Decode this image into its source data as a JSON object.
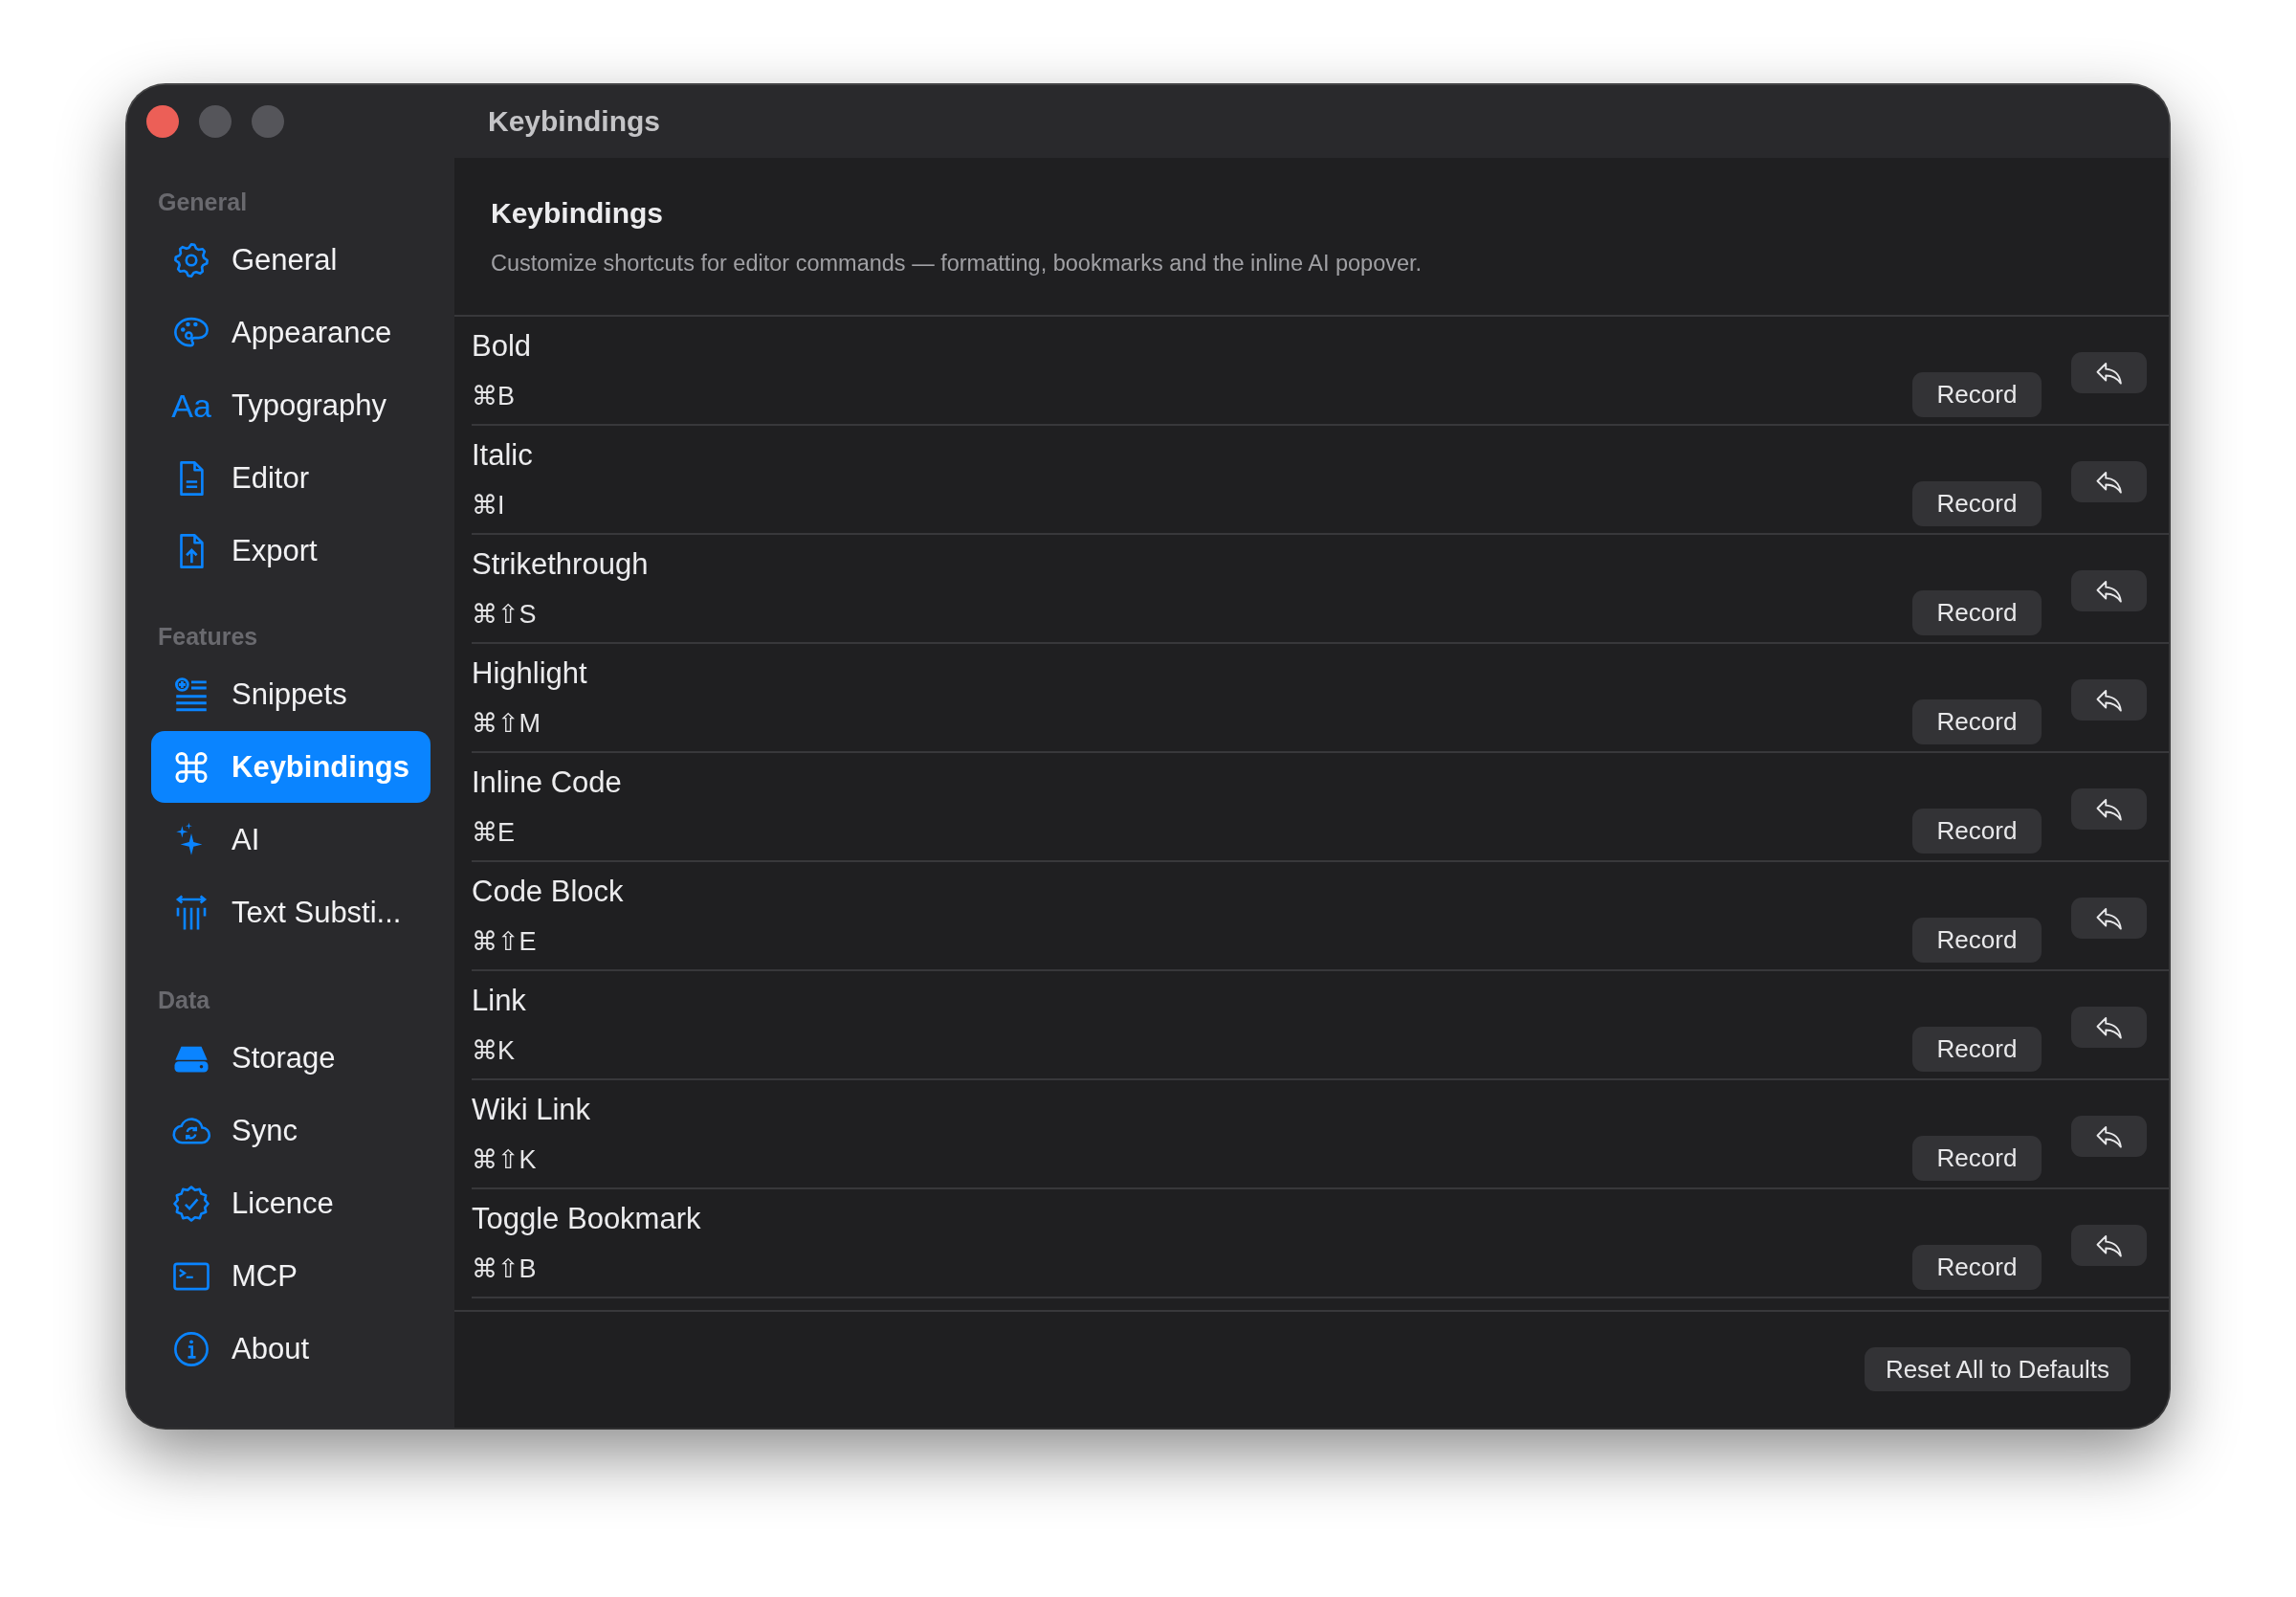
{
  "window": {
    "title": "Keybindings",
    "traffic_lights": [
      {
        "color": "#ec5f57"
      },
      {
        "color": "#55555a"
      },
      {
        "color": "#55555a"
      }
    ]
  },
  "sidebar": {
    "sections": [
      {
        "title": "General",
        "items": [
          {
            "label": "General",
            "selected": false
          },
          {
            "label": "Appearance",
            "selected": false
          },
          {
            "label": "Typography",
            "icon_glyph": "Aa",
            "selected": false
          },
          {
            "label": "Editor",
            "selected": false
          },
          {
            "label": "Export",
            "selected": false
          }
        ]
      },
      {
        "title": "Features",
        "items": [
          {
            "label": "Snippets",
            "selected": false
          },
          {
            "label": "Keybindings",
            "selected": true
          },
          {
            "label": "AI",
            "selected": false
          },
          {
            "label": "Text Substi...",
            "selected": false
          }
        ]
      },
      {
        "title": "Data",
        "items": [
          {
            "label": "Storage",
            "selected": false
          },
          {
            "label": "Sync",
            "selected": false
          },
          {
            "label": "Licence",
            "selected": false
          },
          {
            "label": "MCP",
            "selected": false
          },
          {
            "label": "About",
            "selected": false
          }
        ]
      }
    ]
  },
  "content": {
    "title": "Keybindings",
    "description": "Customize shortcuts for editor commands — formatting, bookmarks and the inline AI popover.",
    "bindings": [
      {
        "name": "Bold",
        "shortcut": "⌘B",
        "button": "Record"
      },
      {
        "name": "Italic",
        "shortcut": "⌘I",
        "button": "Record"
      },
      {
        "name": "Strikethrough",
        "shortcut": "⌘⇧S",
        "button": "Record"
      },
      {
        "name": "Highlight",
        "shortcut": "⌘⇧M",
        "button": "Record"
      },
      {
        "name": "Inline Code",
        "shortcut": "⌘E",
        "button": "Record"
      },
      {
        "name": "Code Block",
        "shortcut": "⌘⇧E",
        "button": "Record"
      },
      {
        "name": "Link",
        "shortcut": "⌘K",
        "button": "Record"
      },
      {
        "name": "Wiki Link",
        "shortcut": "⌘⇧K",
        "button": "Record"
      },
      {
        "name": "Toggle Bookmark",
        "shortcut": "⌘⇧B",
        "button": "Record"
      }
    ],
    "footer_button": "Reset All to Defaults"
  }
}
